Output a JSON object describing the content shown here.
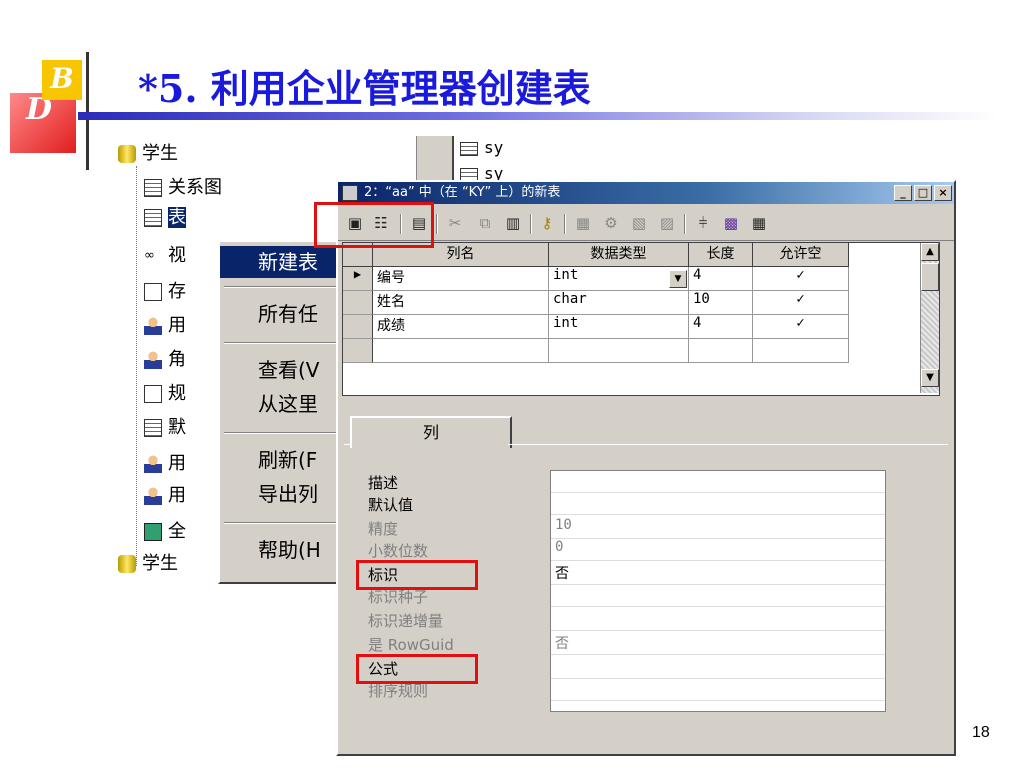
{
  "slide": {
    "logo_top": "B",
    "logo_bottom": "D",
    "title": "*5. 利用企业管理器创建表",
    "page_number": "18"
  },
  "tree": {
    "root": "学生",
    "items": [
      "关系图",
      "表",
      "视",
      "存",
      "用",
      "角",
      "规",
      "默",
      "用",
      "用",
      "全"
    ],
    "root2": "学生"
  },
  "background_list": [
    "sy",
    "sy"
  ],
  "context_menu": {
    "items": [
      "新建表",
      "所有任",
      "查看(V",
      "从这里",
      "刷新(F",
      "导出列",
      "帮助(H"
    ]
  },
  "window": {
    "title": "2：“aa” 中（在 “KY” 上）的新表",
    "buttons": {
      "minimize": "_",
      "maximize": "□",
      "close": "×"
    }
  },
  "toolbar": {
    "icons": [
      "save-icon",
      "properties-icon",
      "manage-icon",
      "cut-icon",
      "copy-icon",
      "paste-icon",
      "key-icon",
      "relationships-icon",
      "indexes-icon",
      "constraints-icon",
      "triggers-icon",
      "diagram-icon",
      "view-icon",
      "grid-icon"
    ]
  },
  "columns_grid": {
    "headers": [
      "列名",
      "数据类型",
      "长度",
      "允许空"
    ],
    "rows": [
      {
        "name": "编号",
        "type": "int",
        "length": "4",
        "nullable": "✓"
      },
      {
        "name": "姓名",
        "type": "char",
        "length": "10",
        "nullable": "✓"
      },
      {
        "name": "成绩",
        "type": "int",
        "length": "4",
        "nullable": "✓"
      }
    ]
  },
  "properties": {
    "tab_label": "列",
    "fields": [
      {
        "label": "描述",
        "value": "",
        "disabled": false
      },
      {
        "label": "默认值",
        "value": "",
        "disabled": false
      },
      {
        "label": "精度",
        "value": "10",
        "disabled": true
      },
      {
        "label": "小数位数",
        "value": "0",
        "disabled": true
      },
      {
        "label": "标识",
        "value": "否",
        "disabled": false
      },
      {
        "label": "标识种子",
        "value": "",
        "disabled": true
      },
      {
        "label": "标识递增量",
        "value": "",
        "disabled": true
      },
      {
        "label": "是 RowGuid",
        "value": "否",
        "disabled": true
      },
      {
        "label": "公式",
        "value": "",
        "disabled": false
      },
      {
        "label": "排序规则",
        "value": "",
        "disabled": true
      }
    ]
  },
  "colors": {
    "title_blue": "#1a1adc",
    "highlight_red": "#e01010",
    "menu_selected": "#0a246a"
  }
}
